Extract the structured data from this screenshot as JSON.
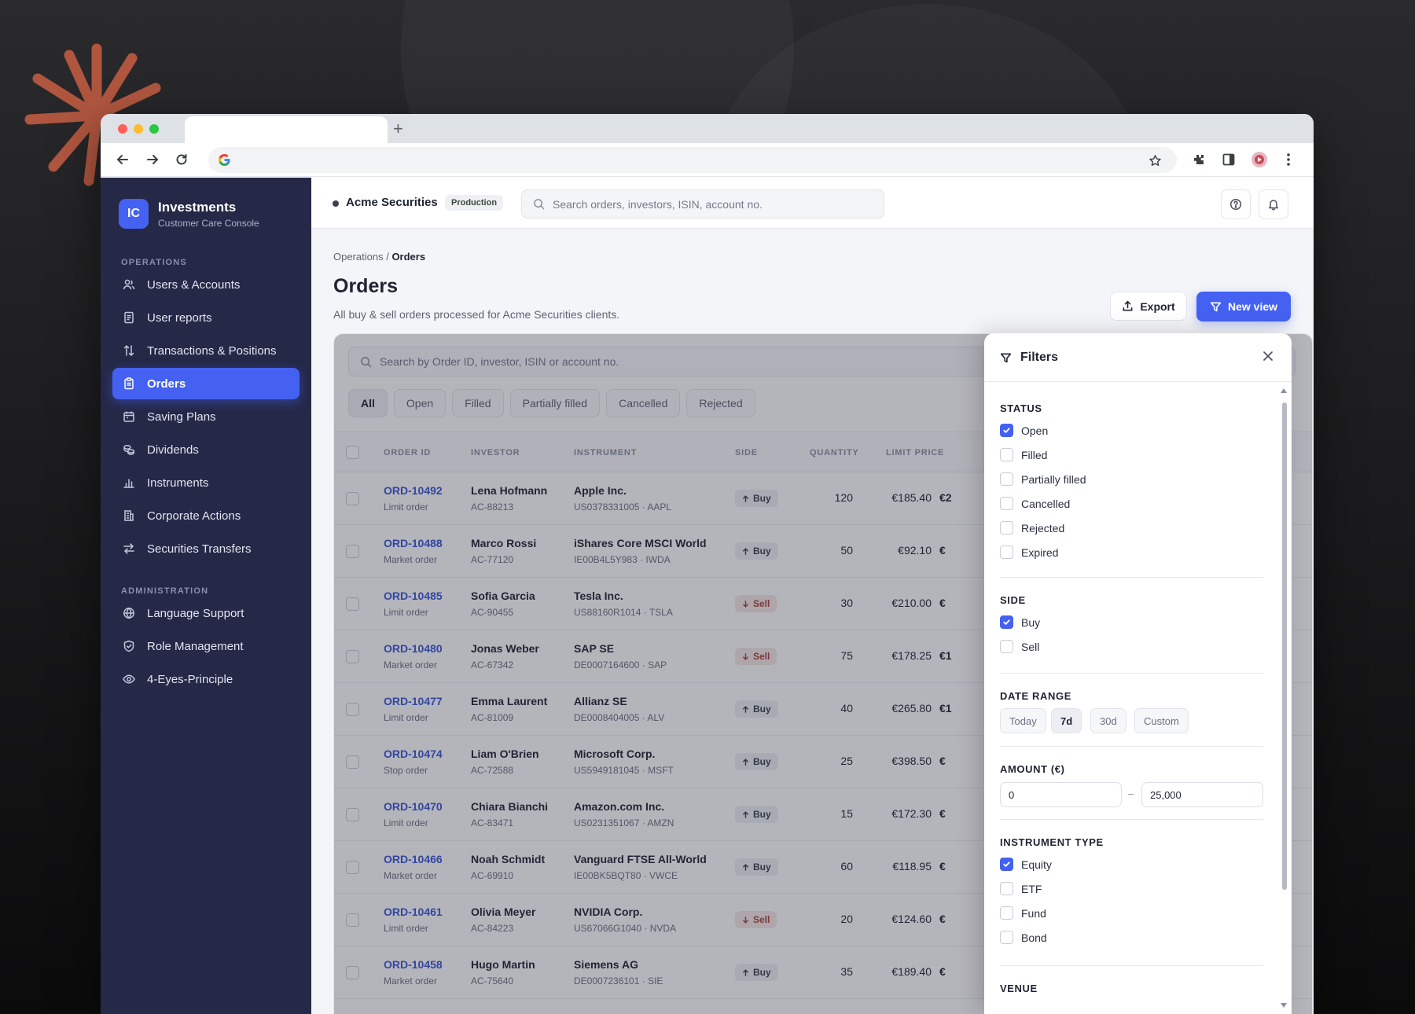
{
  "colors": {
    "accent": "#4461f2",
    "sidebar": "#252847",
    "sell": "#a4453c",
    "burst": "#b0563f"
  },
  "sidebar": {
    "brand_initials": "IC",
    "brand_title": "Investments",
    "brand_subtitle": "Customer Care Console",
    "section_operations": "OPERATIONS",
    "section_admin": "ADMINISTRATION",
    "items": [
      {
        "label": "Users & Accounts",
        "icon": "users-icon"
      },
      {
        "label": "User reports",
        "icon": "report-icon"
      },
      {
        "label": "Transactions & Positions",
        "icon": "arrows-updown-icon"
      },
      {
        "label": "Orders",
        "icon": "clipboard-icon",
        "active": true
      },
      {
        "label": "Saving Plans",
        "icon": "calendar-icon"
      },
      {
        "label": "Dividends",
        "icon": "coins-icon"
      },
      {
        "label": "Instruments",
        "icon": "bar-chart-icon"
      },
      {
        "label": "Corporate Actions",
        "icon": "building-icon"
      },
      {
        "label": "Securities Transfers",
        "icon": "transfer-icon"
      }
    ],
    "admin_items": [
      {
        "label": "Language Support",
        "icon": "globe-icon"
      },
      {
        "label": "Role Management",
        "icon": "shield-icon"
      },
      {
        "label": "4-Eyes-Principle",
        "icon": "eye-icon"
      }
    ]
  },
  "topbar": {
    "org": "Acme Securities",
    "env": "Production",
    "search_placeholder": "Search orders, investors, ISIN, account no."
  },
  "page": {
    "breadcrumb_parent": "Operations",
    "breadcrumb_sep": " / ",
    "breadcrumb_current": "Orders",
    "title": "Orders",
    "subtitle": "All buy & sell orders processed for Acme Securities clients.",
    "export_label": "Export",
    "new_view_label": "New view"
  },
  "table": {
    "search_placeholder": "Search by Order ID, investor, ISIN or account no.",
    "chips": [
      "All",
      "Open",
      "Filled",
      "Partially filled",
      "Cancelled",
      "Rejected"
    ],
    "active_chip": "All",
    "columns": [
      "ORDER ID",
      "INVESTOR",
      "INSTRUMENT",
      "SIDE",
      "QUANTITY",
      "LIMIT PRICE"
    ],
    "rows": [
      {
        "id": "ORD-10492",
        "type": "Limit order",
        "investor": "Lena Hofmann",
        "account": "AC-88213",
        "instrument": "Apple Inc.",
        "isin": "US0378331005 · AAPL",
        "side": "Buy",
        "qty": "120",
        "price": "€185.40",
        "total": "€2"
      },
      {
        "id": "ORD-10488",
        "type": "Market order",
        "investor": "Marco Rossi",
        "account": "AC-77120",
        "instrument": "iShares Core MSCI World",
        "isin": "IE00B4L5Y983 · IWDA",
        "side": "Buy",
        "qty": "50",
        "price": "€92.10",
        "total": "€"
      },
      {
        "id": "ORD-10485",
        "type": "Limit order",
        "investor": "Sofia Garcia",
        "account": "AC-90455",
        "instrument": "Tesla Inc.",
        "isin": "US88160R1014 · TSLA",
        "side": "Sell",
        "qty": "30",
        "price": "€210.00",
        "total": "€"
      },
      {
        "id": "ORD-10480",
        "type": "Market order",
        "investor": "Jonas Weber",
        "account": "AC-67342",
        "instrument": "SAP SE",
        "isin": "DE0007164600 · SAP",
        "side": "Sell",
        "qty": "75",
        "price": "€178.25",
        "total": "€1"
      },
      {
        "id": "ORD-10477",
        "type": "Limit order",
        "investor": "Emma Laurent",
        "account": "AC-81009",
        "instrument": "Allianz SE",
        "isin": "DE0008404005 · ALV",
        "side": "Buy",
        "qty": "40",
        "price": "€265.80",
        "total": "€1"
      },
      {
        "id": "ORD-10474",
        "type": "Stop order",
        "investor": "Liam O'Brien",
        "account": "AC-72588",
        "instrument": "Microsoft Corp.",
        "isin": "US5949181045 · MSFT",
        "side": "Buy",
        "qty": "25",
        "price": "€398.50",
        "total": "€"
      },
      {
        "id": "ORD-10470",
        "type": "Limit order",
        "investor": "Chiara Bianchi",
        "account": "AC-83471",
        "instrument": "Amazon.com Inc.",
        "isin": "US0231351067 · AMZN",
        "side": "Buy",
        "qty": "15",
        "price": "€172.30",
        "total": "€"
      },
      {
        "id": "ORD-10466",
        "type": "Market order",
        "investor": "Noah Schmidt",
        "account": "AC-69910",
        "instrument": "Vanguard FTSE All-World",
        "isin": "IE00BK5BQT80 · VWCE",
        "side": "Buy",
        "qty": "60",
        "price": "€118.95",
        "total": "€"
      },
      {
        "id": "ORD-10461",
        "type": "Limit order",
        "investor": "Olivia Meyer",
        "account": "AC-84223",
        "instrument": "NVIDIA Corp.",
        "isin": "US67066G1040 · NVDA",
        "side": "Sell",
        "qty": "20",
        "price": "€124.60",
        "total": "€"
      },
      {
        "id": "ORD-10458",
        "type": "Market order",
        "investor": "Hugo Martin",
        "account": "AC-75640",
        "instrument": "Siemens AG",
        "isin": "DE0007236101 · SIE",
        "side": "Buy",
        "qty": "35",
        "price": "€189.40",
        "total": "€"
      }
    ]
  },
  "filters": {
    "title": "Filters",
    "status_label": "STATUS",
    "status": [
      {
        "label": "Open",
        "checked": true
      },
      {
        "label": "Filled",
        "checked": false
      },
      {
        "label": "Partially filled",
        "checked": false
      },
      {
        "label": "Cancelled",
        "checked": false
      },
      {
        "label": "Rejected",
        "checked": false
      },
      {
        "label": "Expired",
        "checked": false
      }
    ],
    "side_label": "SIDE",
    "side": [
      {
        "label": "Buy",
        "checked": true
      },
      {
        "label": "Sell",
        "checked": false
      }
    ],
    "date_label": "DATE RANGE",
    "date_options": [
      "Today",
      "7d",
      "30d",
      "Custom"
    ],
    "date_active": "7d",
    "amount_label": "AMOUNT (€)",
    "amount_min": "0",
    "amount_sep": "–",
    "amount_max": "25,000",
    "instrument_label": "INSTRUMENT TYPE",
    "instrument": [
      {
        "label": "Equity",
        "checked": true
      },
      {
        "label": "ETF",
        "checked": false
      },
      {
        "label": "Fund",
        "checked": false
      },
      {
        "label": "Bond",
        "checked": false
      }
    ],
    "venue_label": "VENUE"
  }
}
